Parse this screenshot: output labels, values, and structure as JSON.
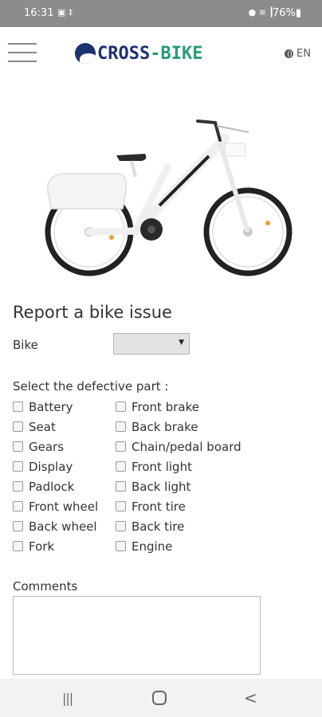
{
  "status_bar": {
    "time": "16:31",
    "left_icons": "▣ ‡",
    "right_icons": "● ≋ ┃",
    "battery": "76%▮"
  },
  "header": {
    "logo_part1": "CROSS",
    "logo_part2": "-BIKE",
    "language": "EN",
    "brand_colors": {
      "navy": "#1c3270",
      "green": "#2b9a7c"
    }
  },
  "form": {
    "title": "Report a bike issue",
    "bike_label": "Bike",
    "bike_selected": "",
    "parts_label": "Select the defective part :",
    "parts_left": [
      "Battery",
      "Seat",
      "Gears",
      "Display",
      "Padlock",
      "Front wheel",
      "Back wheel",
      "Fork"
    ],
    "parts_right": [
      "Front brake",
      "Back brake",
      "Chain/pedal board",
      "Front light",
      "Back light",
      "Front tire",
      "Back tire",
      "Engine"
    ],
    "comments_label": "Comments"
  },
  "nav_bar": {
    "recent": "|||",
    "back": "<"
  }
}
